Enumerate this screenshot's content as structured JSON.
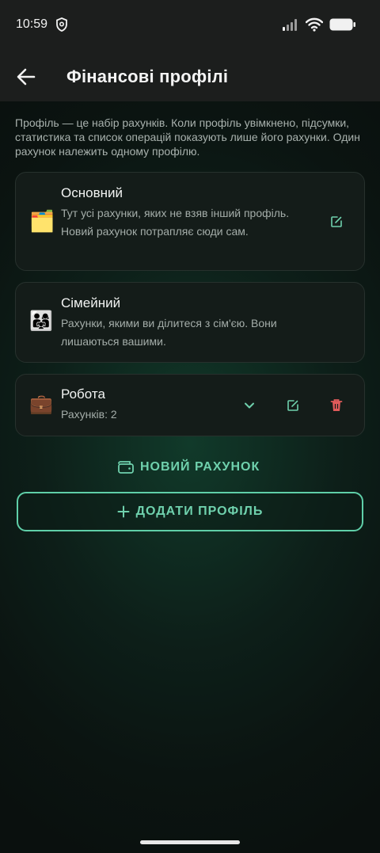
{
  "status": {
    "time": "10:59"
  },
  "header": {
    "title": "Фінансові профілі"
  },
  "intro_text": "Профіль — це набір рахунків. Коли профіль увімкнено, підсумки, статистика та список операцій показують лише його рахунки. Один рахунок належить одному профілю.",
  "profiles": [
    {
      "emoji": "🗂️",
      "name": "Основний",
      "description": "Тут усі рахунки, яких не взяв інший профіль. Новий рахунок потрапляє сюди сам."
    },
    {
      "emoji": "👨‍👩‍👧",
      "name": "Сімейний",
      "description": "Рахунки, якими ви ділитеся з сім'єю. Вони лишаються вашими."
    },
    {
      "emoji": "💼",
      "name": "Робота",
      "description": "Рахунків: 2"
    }
  ],
  "actions": {
    "new_account_label": "НОВИЙ РАХУНОК",
    "add_profile_label": "ДОДАТИ ПРОФІЛЬ"
  },
  "colors": {
    "accent": "#6fd1ad",
    "delete": "#e05a5a",
    "card_bg": "#141c19"
  }
}
